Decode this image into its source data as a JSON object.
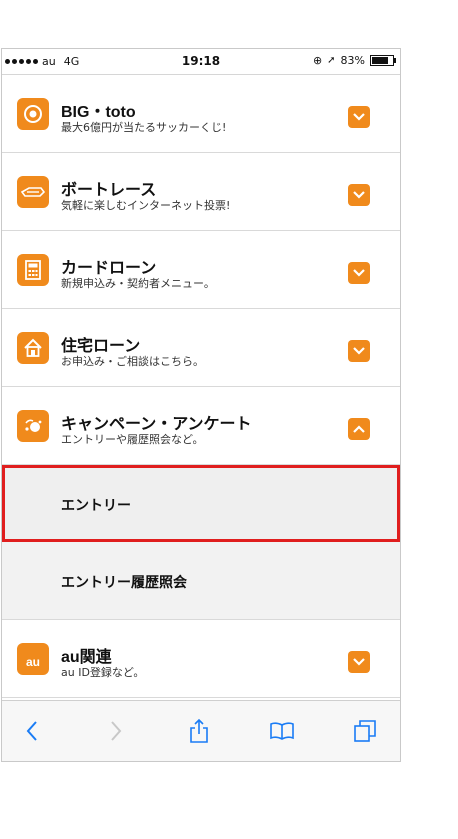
{
  "status_bar": {
    "carrier": "au",
    "network": "4G",
    "time": "19:18",
    "battery": "83%"
  },
  "menu": {
    "items": [
      {
        "title": "BIG・toto",
        "subtitle": "最大6億円が当たるサッカーくじ!",
        "icon": "soccer-ball-icon"
      },
      {
        "title": "ボートレース",
        "subtitle": "気軽に楽しむインターネット投票!",
        "icon": "boat-icon"
      },
      {
        "title": "カードローン",
        "subtitle": "新規申込み・契約者メニュー。",
        "icon": "calculator-icon"
      },
      {
        "title": "住宅ローン",
        "subtitle": "お申込み・ご相談はこちら。",
        "icon": "house-icon"
      },
      {
        "title": "キャンペーン・アンケート",
        "subtitle": "エントリーや履歴照会など。",
        "icon": "campaign-icon"
      }
    ],
    "expanded_items": [
      {
        "label": "エントリー"
      },
      {
        "label": "エントリー履歴照会"
      }
    ],
    "last_item": {
      "title": "au関連",
      "subtitle": "au ID登録など。",
      "icon": "au-icon",
      "icon_text": "au"
    }
  },
  "colors": {
    "accent": "#f08a1c",
    "highlight_border": "#e01e1e",
    "toolbar_icon": "#1a7cf5"
  },
  "toolbar": {
    "icons": [
      "back-icon",
      "forward-icon",
      "share-icon",
      "bookmarks-icon",
      "tabs-icon"
    ]
  }
}
